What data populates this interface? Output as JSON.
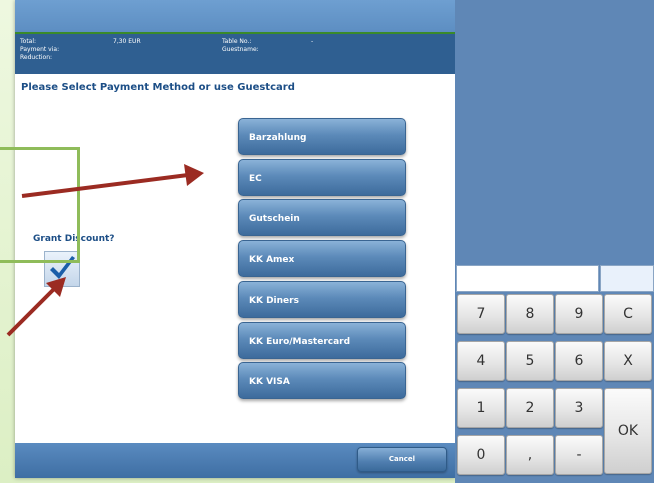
{
  "info": {
    "total_label": "Total:",
    "total_value": "7,30 EUR",
    "payment_via_label": "Payment via:",
    "reduction_label": "Reduction:",
    "table_label": "Table No.:",
    "table_value": "-",
    "guestname_label": "Guestname:"
  },
  "heading": "Please Select Payment Method or use Guestcard",
  "payment_methods": [
    "Barzahlung",
    "EC",
    "Gutschein",
    "KK Amex",
    "KK Diners",
    "KK Euro/Mastercard",
    "KK VISA"
  ],
  "grant_discount_label": "Grant Discount?",
  "grant_discount_checked": true,
  "cancel_label": "Cancel",
  "keypad": {
    "k7": "7",
    "k8": "8",
    "k9": "9",
    "kC": "C",
    "k4": "4",
    "k5": "5",
    "k6": "6",
    "kX": "X",
    "k1": "1",
    "k2": "2",
    "k3": "3",
    "kOK": "OK",
    "k0": "0",
    "kComma": ",",
    "kMinus": "-"
  },
  "colors": {
    "header_blue": "#2f5f91",
    "button_blue": "#5c8ab9",
    "annotation_arrow": "#9b2b22",
    "annotation_box": "#8fbc5a",
    "check_blue": "#1b5ea8"
  }
}
